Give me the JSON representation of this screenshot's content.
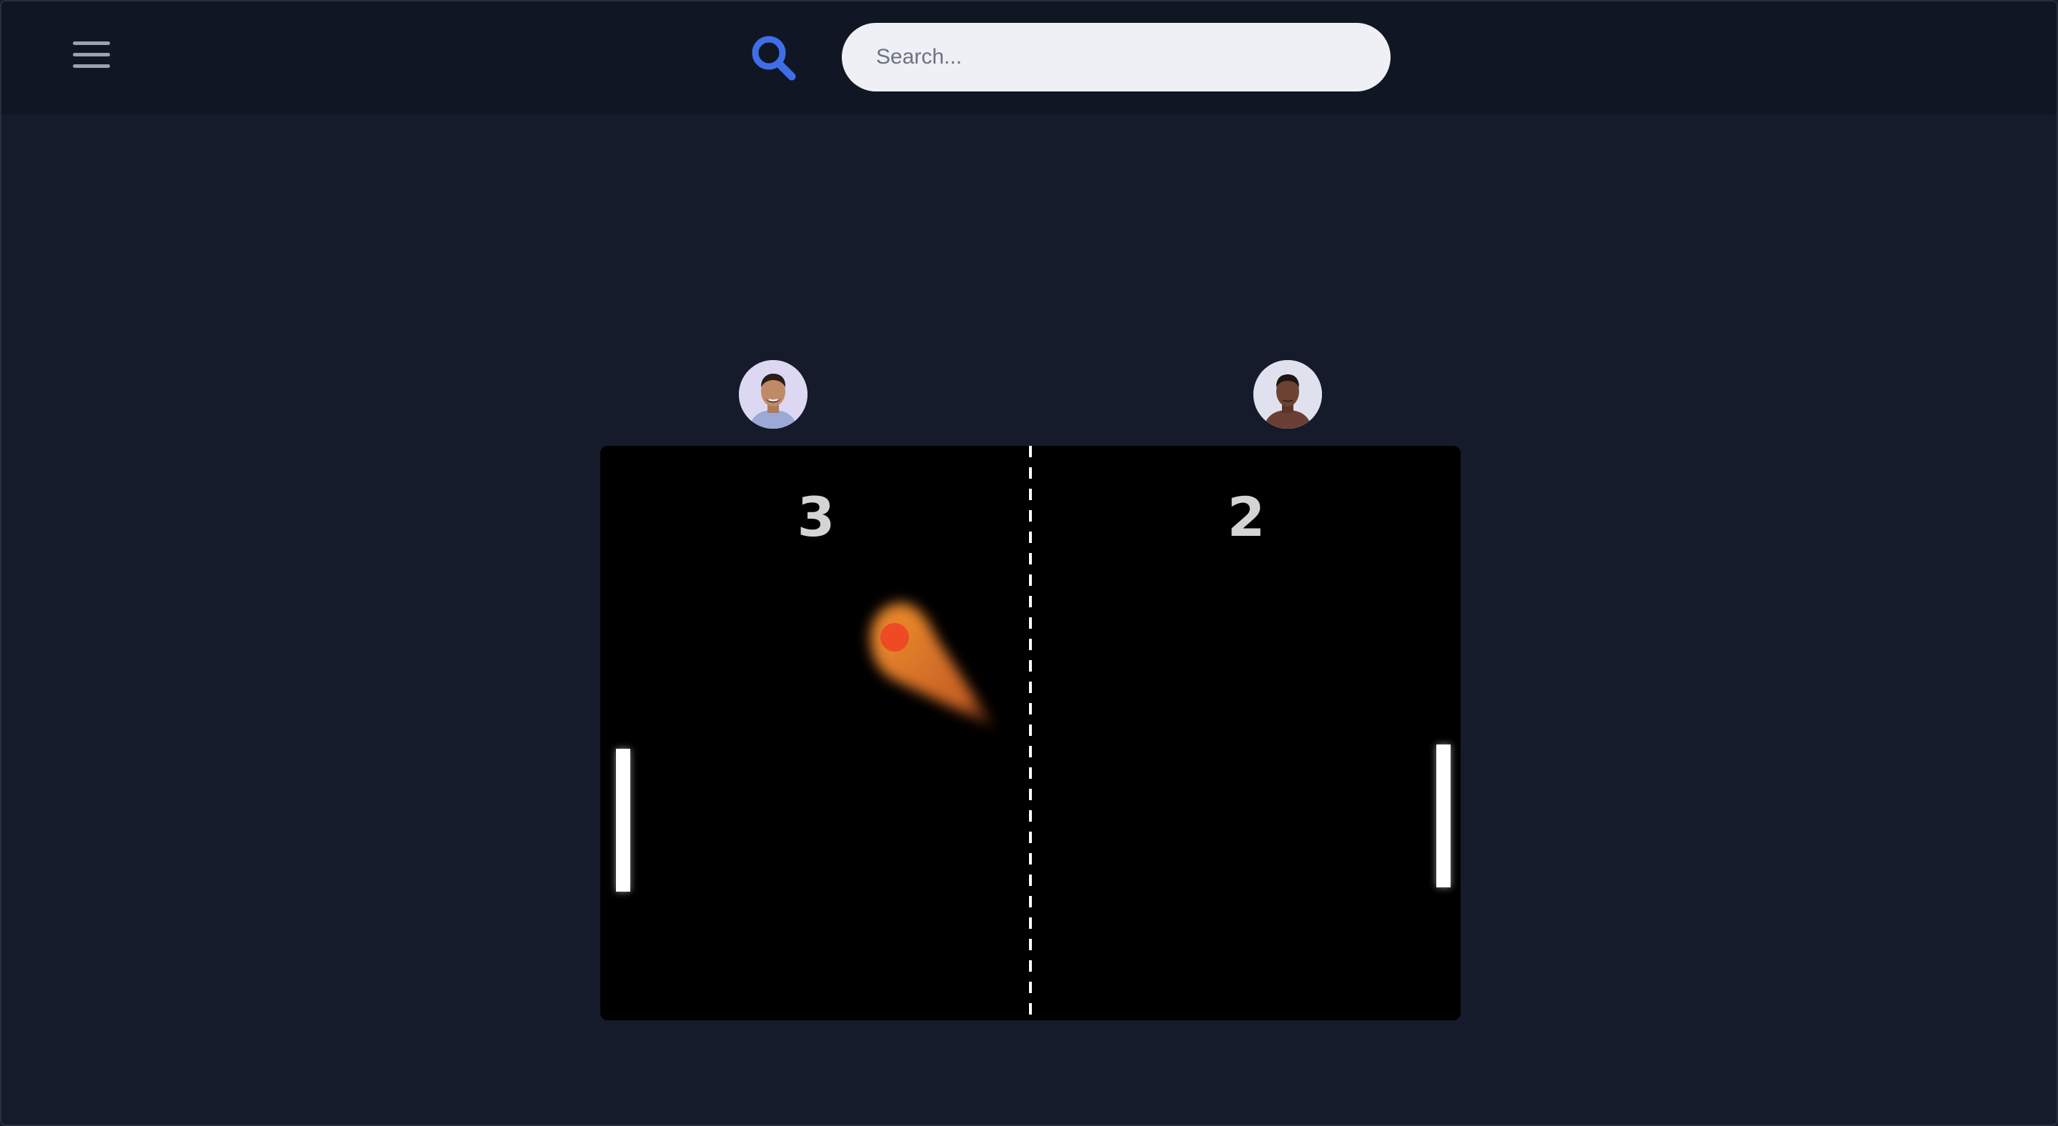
{
  "header": {
    "search": {
      "placeholder": "Search...",
      "value": ""
    },
    "icons": {
      "menu": "hamburger-menu-icon",
      "search": "search-icon"
    }
  },
  "game": {
    "players": [
      {
        "avatar_icon": "player-one-avatar",
        "score": "3"
      },
      {
        "avatar_icon": "player-two-avatar",
        "score": "2"
      }
    ]
  },
  "colors": {
    "background": "#161b2c",
    "header": "#111624",
    "accent": "#3f6ee8",
    "board": "#000000",
    "ball": "#ee4a24",
    "trail": "#f28a2e"
  }
}
